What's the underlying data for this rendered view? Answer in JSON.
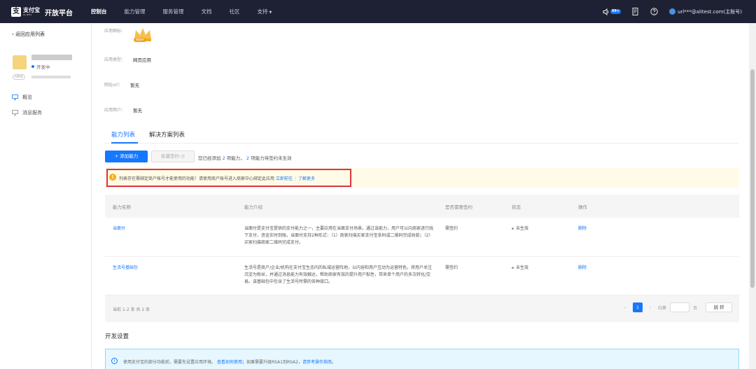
{
  "header": {
    "logo_brand": "支付宝",
    "logo_sub": "ALIPAY",
    "logo_title": "开放平台",
    "nav": [
      "控制台",
      "能力管理",
      "服务管理",
      "文档",
      "社区",
      "支持"
    ],
    "notification_badge": "99+",
    "user": "url***@alitest.com(主账号)"
  },
  "sidebar": {
    "back_link": "返回应用列表",
    "app_status": "开发中",
    "appid_tag": "APPID",
    "menu": [
      "概览",
      "消息服务"
    ]
  },
  "app_info": {
    "icon_label": "应用图标：",
    "icon_badge": "审核中",
    "type_label": "应用类型：",
    "type_value": "网页应用",
    "url_label": "网址url：",
    "url_value": "暂无",
    "intro_label": "应用简介：",
    "intro_value": "暂无"
  },
  "tabs": [
    "能力列表",
    "解决方案列表"
  ],
  "toolbar": {
    "add_button": "+ 添加能力",
    "batch_button": "批量签约",
    "summary_prefix": "您已经添加",
    "summary_count": "2",
    "summary_middle": "项能力，",
    "summary_pending": "2",
    "summary_suffix": "项能力待签约未生效"
  },
  "notice": {
    "text": "列表存在需绑定商户帐号才能使用的功能！请使用商户账号进入商家中心绑定此应用",
    "link1": "立即前往",
    "link2": "了解更多"
  },
  "table": {
    "headers": [
      "能力名称",
      "能力介绍",
      "是否需要签约",
      "状态",
      "操作"
    ],
    "rows": [
      {
        "name": "当面付",
        "desc": "当面付是支付宝提供的支付能力之一，主要应用在当面支付场景。通过该能力，用户可以向商家进行线下支付，资金实时到账。当面付支持2种形式：（1）商家扫描买家支付宝条码或二维码完成收款；（2）买家扫描商家二维码完成支付。",
        "sign": "需签约",
        "status": "未生效",
        "action": "删除"
      },
      {
        "name": "生活号基础包",
        "desc": "生活号是商户/企业/机构在支付宝生态内的私域运营阵地，以内容和用户互动为运营特色，将用户关注沉淀为粉丝，并通过消息能力有效触达，帮助商家有效的提升用户黏性，带来单个用户的多次转化/交易。该基础包中包含了生活号所需的各种接口。",
        "sign": "需签约",
        "status": "未生效",
        "action": "删除"
      }
    ]
  },
  "pagination": {
    "total": "当前 1-2 条 共 2 条",
    "current_page": "1",
    "goto_label": "向第",
    "page_suffix": "页",
    "jump_button": "跳 转"
  },
  "dev_settings": {
    "title": "开发设置",
    "info_text": "使用支付宝的部分功能前，需要先设置应用环境。",
    "info_link1": "查看如何使用",
    "info_middle": "；如果需要升级RSA1到RSA2，",
    "info_link2": "请参考操作指南",
    "info_end": "。"
  },
  "colors": {
    "topbar": "#1e2133",
    "accent": "#1677ff",
    "warning_bg": "#fffbe6",
    "highlight_border": "#d9363e"
  }
}
